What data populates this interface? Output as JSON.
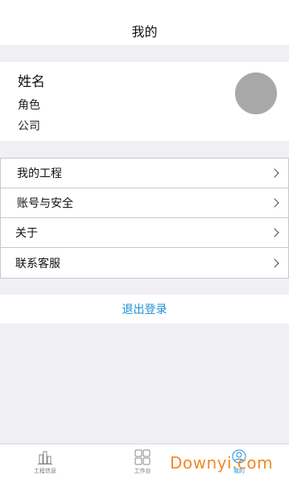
{
  "header": {
    "title": "我的"
  },
  "profile": {
    "name": "姓名",
    "role": "角色",
    "company": "公司"
  },
  "menu": {
    "items": [
      {
        "label": "我的工程"
      },
      {
        "label": "账号与安全"
      },
      {
        "label": "关于"
      },
      {
        "label": "联系客服"
      }
    ]
  },
  "logout": {
    "label": "退出登录"
  },
  "tabbar": {
    "tabs": [
      {
        "label": "工程信息",
        "icon": "building-chart-icon",
        "active": false
      },
      {
        "label": "工作台",
        "icon": "grid-icon",
        "active": false
      },
      {
        "label": "我的",
        "icon": "user-icon",
        "active": true
      }
    ]
  },
  "watermark": {
    "text": "Downyi.com"
  },
  "colors": {
    "accent": "#1a8fd6",
    "background": "#efeff4",
    "watermark": "#f08a24"
  }
}
